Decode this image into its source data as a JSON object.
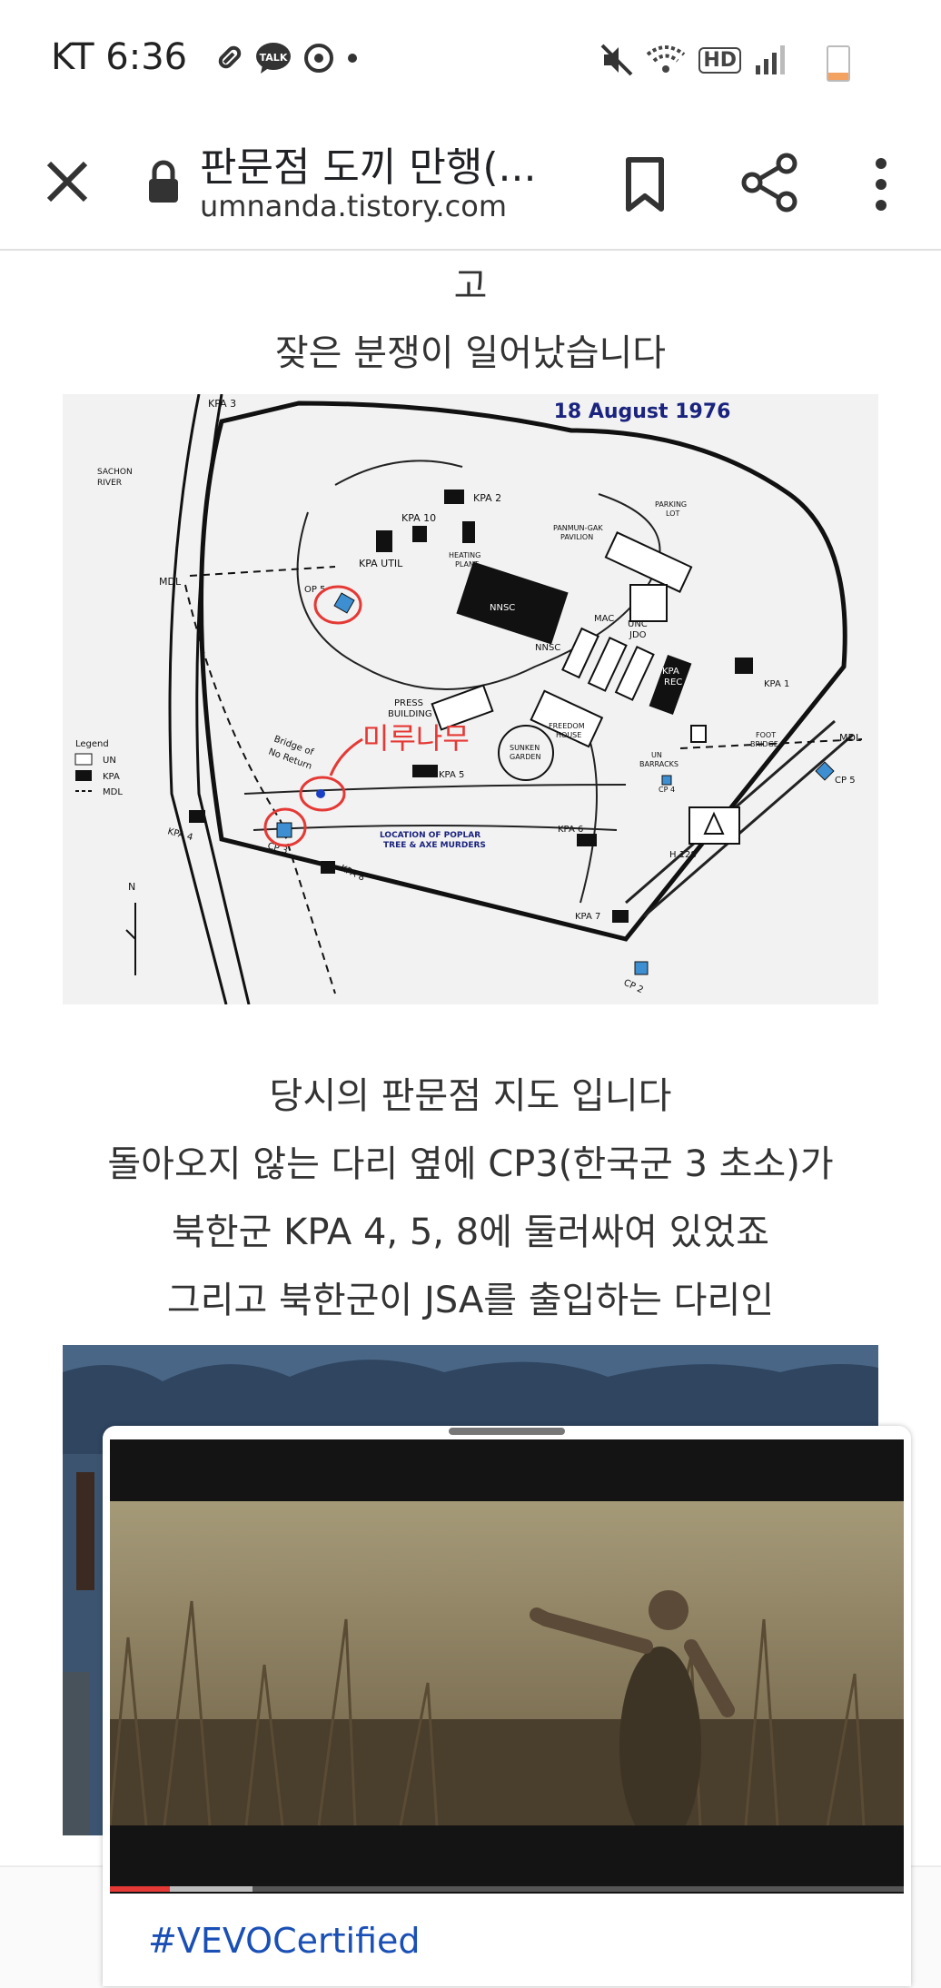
{
  "status_bar": {
    "carrier_time": "KT 6:36",
    "talk_badge": "TALK",
    "hd_badge": "HD",
    "icons": [
      "pill-icon",
      "kakaotalk-icon",
      "sync-icon",
      "dot-icon",
      "mute-icon",
      "wifi-icon",
      "hd-icon",
      "signal-icon",
      "battery-icon"
    ]
  },
  "toolbar": {
    "title": "판문점 도끼 만행(...",
    "url": "umnanda.tistory.com"
  },
  "article": {
    "lines_top": [
      "고",
      "잦은 분쟁이 일어났습니다"
    ],
    "lines_after_map": [
      "당시의 판문점 지도 입니다",
      "돌아오지 않는 다리 옆에 CP3(한국군 3 초소)가",
      "북한군 KPA 4, 5, 8에 둘러싸여 있었죠",
      "그리고 북한군이 JSA를 출입하는 다리인"
    ]
  },
  "map": {
    "date": "18 August 1976",
    "annotation": "미루나무",
    "labels": {
      "kpa3": "KPA 3",
      "sachon": "SACHON",
      "river": "RIVER",
      "kpa2": "KPA 2",
      "kpa10": "KPA 10",
      "kpa_util": "KPA UTIL",
      "heating": "HEATING",
      "plant": "PLANT",
      "parking": "PARKING",
      "lot": "LOT",
      "panmungak": "PANMUN-GAK",
      "pavilion": "PAVILION",
      "mdl": "MDL",
      "op5": "OP 5",
      "nnsc": "NNSC",
      "nnsc2": "NNSC",
      "mac": "MAC",
      "unc": "UNC",
      "jdo": "JDO",
      "kpa": "KPA",
      "rec": "REC",
      "kpa1": "KPA 1",
      "press": "PRESS",
      "building": "BUILDING",
      "freedom": "FREEDOM",
      "house": "HOUSE",
      "sunken": "SUNKEN",
      "garden": "GARDEN",
      "legend": "Legend",
      "un": "UN",
      "kpa_leg": "KPA",
      "mdl_leg": "MDL",
      "bridge1": "Bridge of",
      "bridge2": "No Return",
      "kpa5": "KPA 5",
      "un_b": "UN",
      "barracks": "BARRACKS",
      "cp4": "CP 4",
      "foot": "FOOT",
      "bridge": "BRIDGE",
      "mdl_r": "MDL",
      "cp5": "CP 5",
      "kpa4": "KPA 4",
      "cp3": "CP 3",
      "loc1": "LOCATION OF POPLAR",
      "loc2": "TREE & AXE MURDERS",
      "kpa8": "KPA 8",
      "kpa6": "KPA 6",
      "h128": "H 128",
      "north": "N",
      "kpa7": "KPA 7",
      "cp2": "CP 2"
    }
  },
  "video": {
    "tag": "#VEVOCertified",
    "progress_played": 0.075,
    "progress_buffered": 0.18
  },
  "colors": {
    "map_date": "#1a237e",
    "annotation_red": "#e53935",
    "un_post_blue": "#3d8fd1",
    "vevo_tag": "#1a4fb5"
  }
}
